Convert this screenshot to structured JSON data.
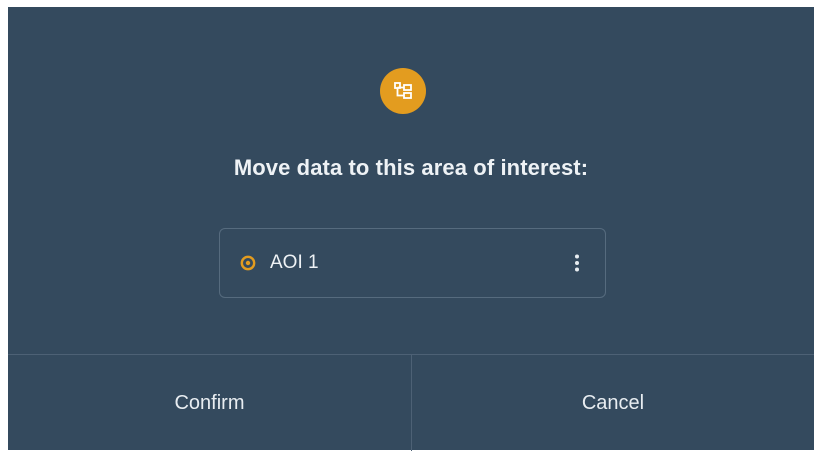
{
  "dialog": {
    "header_icon": "folder-tree-icon",
    "title": "Move data to this area of interest:",
    "accent_color": "#e39c1f",
    "background_color": "#344a5e"
  },
  "aoi_item": {
    "icon": "aoi-target-icon",
    "name": "AOI 1",
    "menu_icon": "more-vertical-icon"
  },
  "actions": {
    "confirm_label": "Confirm",
    "cancel_label": "Cancel"
  }
}
